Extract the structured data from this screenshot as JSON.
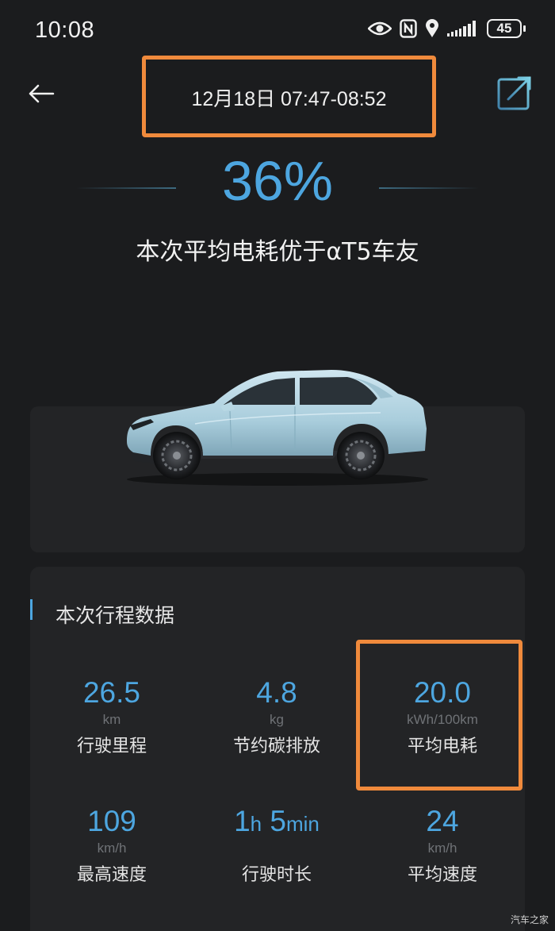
{
  "status_bar": {
    "time": "10:08",
    "battery": "45",
    "icons": [
      "eye-icon",
      "nfc-icon",
      "location-icon",
      "signal-icon",
      "battery-icon"
    ]
  },
  "header": {
    "title": "12月18日 07:47-08:52",
    "back_icon": "arrow-left-icon",
    "share_icon": "share-export-icon"
  },
  "hero": {
    "percent": "36%",
    "compare_text": "本次平均电耗优于αT5车友"
  },
  "stats": {
    "section_title": "本次行程数据",
    "items": [
      {
        "value": "26.5",
        "unit": "km",
        "label": "行驶里程"
      },
      {
        "value": "4.8",
        "unit": "kg",
        "label": "节约碳排放"
      },
      {
        "value": "20.0",
        "unit": "kWh/100km",
        "label": "平均电耗"
      },
      {
        "value": "109",
        "unit": "km/h",
        "label": "最高速度"
      },
      {
        "duration_h": "1",
        "duration_h_unit": "h",
        "duration_min": "5",
        "duration_min_unit": "min",
        "label": "行驶时长"
      },
      {
        "value": "24",
        "unit": "km/h",
        "label": "平均速度"
      }
    ]
  },
  "watermark": "汽车之家",
  "colors": {
    "background": "#1b1c1e",
    "card": "#232426",
    "accent_blue": "#4da6e0",
    "highlight_orange": "#f08a3c"
  }
}
